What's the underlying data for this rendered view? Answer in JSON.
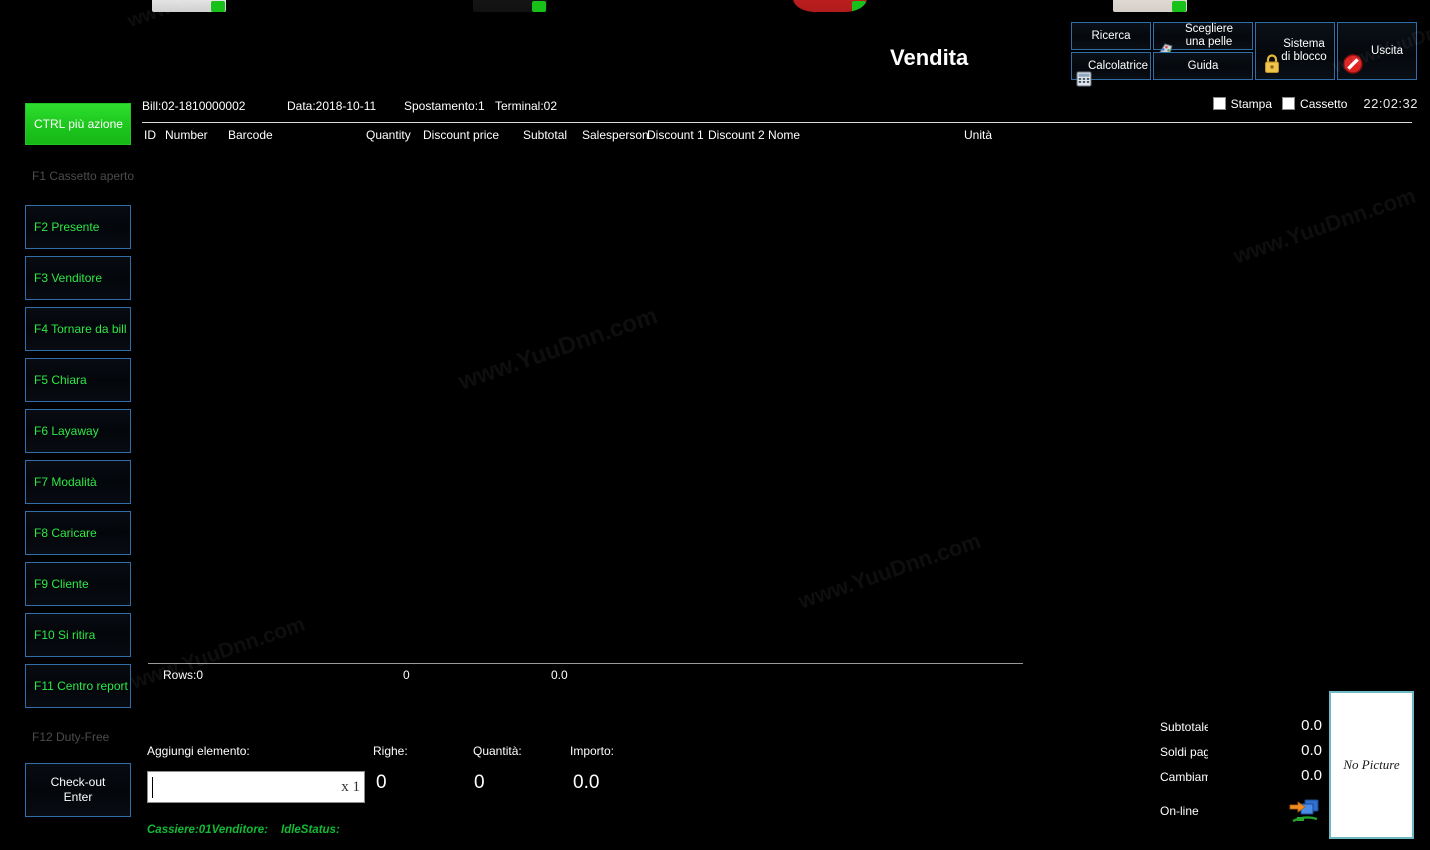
{
  "window": {
    "title": "Vendita"
  },
  "toolbar": {
    "buttons": [
      {
        "label": "Ricerca",
        "icon": "none"
      },
      {
        "label": "Calcolatrice",
        "icon": "calculator-icon"
      },
      {
        "label": "Scegliere\nuna pelle",
        "icon": "skin-palette-icon"
      },
      {
        "label": "Guida",
        "icon": "none"
      },
      {
        "label": "Sistema\ndi blocco",
        "icon": "lock-icon"
      },
      {
        "label": "Uscita",
        "icon": "exit-forbidden-icon"
      }
    ],
    "checkboxes": [
      {
        "label": "Stampa",
        "checked": false
      },
      {
        "label": "Cassetto",
        "checked": false
      }
    ],
    "clock": "22:02:32"
  },
  "sidebar": {
    "primary": {
      "label": "CTRL più azione"
    },
    "items": [
      {
        "label": "F1 Cassetto aperto",
        "enabled": false
      },
      {
        "label": "F2 Presente",
        "enabled": true
      },
      {
        "label": "F3 Venditore",
        "enabled": true
      },
      {
        "label": "F4 Tornare da bill",
        "enabled": true
      },
      {
        "label": "F5 Chiara",
        "enabled": true
      },
      {
        "label": "F6 Layaway",
        "enabled": true
      },
      {
        "label": "F7 Modalità",
        "enabled": true
      },
      {
        "label": "F8 Caricare",
        "enabled": true
      },
      {
        "label": "F9 Cliente",
        "enabled": true
      },
      {
        "label": "F10 Si ritira",
        "enabled": true
      },
      {
        "label": "F11 Centro report",
        "enabled": true
      },
      {
        "label": "F12 Duty-Free",
        "enabled": false
      }
    ],
    "checkout": {
      "label": "Check-out\nEnter"
    }
  },
  "bill_info": {
    "bill": "Bill:02-1810000002",
    "data": "Data:2018-10-11",
    "spostamento": "Spostamento:1",
    "terminal": "Terminal:02"
  },
  "grid": {
    "columns": [
      "ID",
      "Number",
      "Barcode",
      "Quantity",
      "Discount price",
      "Subtotal",
      "Salesperson",
      "Discount 1",
      "Discount 2 Nome",
      "Unità"
    ],
    "rows": [],
    "footer": {
      "rows_label": "Rows:0",
      "quantity_total": "0",
      "amount_total": "0.0"
    }
  },
  "entry": {
    "add_item_label": "Aggiungi elemento:",
    "input_value": "",
    "multiplier": "x 1",
    "righe_label": "Righe:",
    "righe_value": "0",
    "quantita_label": "Quantità:",
    "quantita_value": "0",
    "importo_label": "Importo:",
    "importo_value": "0.0"
  },
  "status": {
    "cashier": "Cassiere:01Venditore:",
    "idle": "IdleStatus:"
  },
  "totals": {
    "rows": [
      {
        "label": "Subtotale",
        "value": "0.0"
      },
      {
        "label": "Soldi paga",
        "value": "0.0"
      },
      {
        "label": "Cambiame",
        "value": "0.0"
      }
    ],
    "online_label": "On-line",
    "no_picture": "No Picture"
  },
  "colors": {
    "accent_green": "#2ee846",
    "button_border": "#2f6ea8",
    "background": "#000000",
    "status_green": "#12bb34"
  },
  "watermarks": [
    "www.YuuDnn.com",
    "www.YuuDnn.com",
    "www.YuuDnn.com",
    "www.YuuDnn.com",
    "www.YuuDnn.com",
    "www.YuuDnn.com"
  ]
}
